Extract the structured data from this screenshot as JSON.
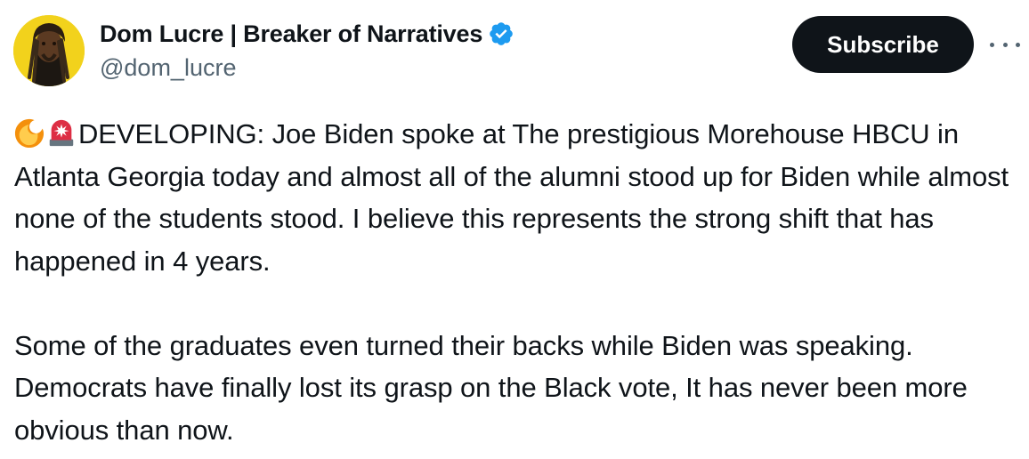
{
  "author": {
    "display_name": "Dom Lucre | Breaker of Narratives",
    "handle": "@dom_lucre",
    "verified": true,
    "avatar_icon": "profile-avatar"
  },
  "actions": {
    "subscribe_label": "Subscribe",
    "more_icon": "more-horizontal-icon"
  },
  "tweet": {
    "emojis": [
      "fire-emoji",
      "siren-emoji"
    ],
    "paragraph1": "DEVELOPING: Joe Biden spoke at The prestigious Morehouse HBCU in Atlanta Georgia today and almost all of the alumni stood up for Biden while almost none of the students stood. I believe this represents the strong shift that has happened in 4 years.",
    "paragraph2": "Some of the graduates even turned their backs while Biden was speaking. Democrats have finally lost its grasp on the Black vote, It has never been more obvious than now."
  },
  "colors": {
    "text": "#0f1419",
    "secondary_text": "#536471",
    "verified_blue": "#1d9bf0",
    "button_bg": "#0f1419",
    "avatar_bg": "#f2d21c"
  }
}
